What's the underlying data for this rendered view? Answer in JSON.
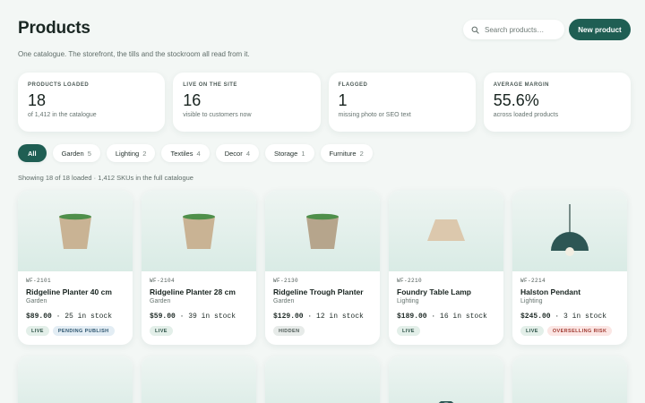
{
  "header": {
    "title": "Products",
    "search_placeholder": "Search products…",
    "new_product_label": "New product"
  },
  "subtitle": "One catalogue. The storefront, the tills and the stockroom all read from it.",
  "stats": [
    {
      "label": "PRODUCTS LOADED",
      "value": "18",
      "sub": "of 1,412 in the catalogue"
    },
    {
      "label": "LIVE ON THE SITE",
      "value": "16",
      "sub": "visible to customers now"
    },
    {
      "label": "FLAGGED",
      "value": "1",
      "sub": "missing photo or SEO text"
    },
    {
      "label": "AVERAGE MARGIN",
      "value": "55.6%",
      "sub": "across loaded products"
    }
  ],
  "filters": [
    {
      "label": "All",
      "count": ""
    },
    {
      "label": "Garden",
      "count": "5"
    },
    {
      "label": "Lighting",
      "count": "2"
    },
    {
      "label": "Textiles",
      "count": "4"
    },
    {
      "label": "Decor",
      "count": "4"
    },
    {
      "label": "Storage",
      "count": "1"
    },
    {
      "label": "Furniture",
      "count": "2"
    }
  ],
  "showing": "Showing 18 of 18 loaded · 1,412 SKUs in the full catalogue",
  "products": [
    {
      "sku": "WF-2101",
      "name": "Ridgeline Planter 40 cm",
      "category": "Garden",
      "price": "$89.00",
      "stock": "25 in stock",
      "badges": [
        "LIVE",
        "PENDING PUBLISH"
      ],
      "icon": "planter-icon"
    },
    {
      "sku": "WF-2104",
      "name": "Ridgeline Planter 28 cm",
      "category": "Garden",
      "price": "$59.00",
      "stock": "39 in stock",
      "badges": [
        "LIVE"
      ],
      "icon": "planter-icon"
    },
    {
      "sku": "WF-2130",
      "name": "Ridgeline Trough Planter",
      "category": "Garden",
      "price": "$129.00",
      "stock": "12 in stock",
      "badges": [
        "HIDDEN"
      ],
      "icon": "planter-icon"
    },
    {
      "sku": "WF-2210",
      "name": "Foundry Table Lamp",
      "category": "Lighting",
      "price": "$189.00",
      "stock": "16 in stock",
      "badges": [
        "LIVE"
      ],
      "icon": "lamp-shade-icon"
    },
    {
      "sku": "WF-2214",
      "name": "Halston Pendant",
      "category": "Lighting",
      "price": "$245.00",
      "stock": "3 in stock",
      "badges": [
        "LIVE",
        "OVERSELLING RISK"
      ],
      "icon": "pendant-lamp-icon"
    }
  ],
  "colors": {
    "accent": "#1f5e53",
    "background": "#f3f7f5",
    "badge_live": "#e3efe9",
    "badge_risk": "#fbe6e4"
  }
}
